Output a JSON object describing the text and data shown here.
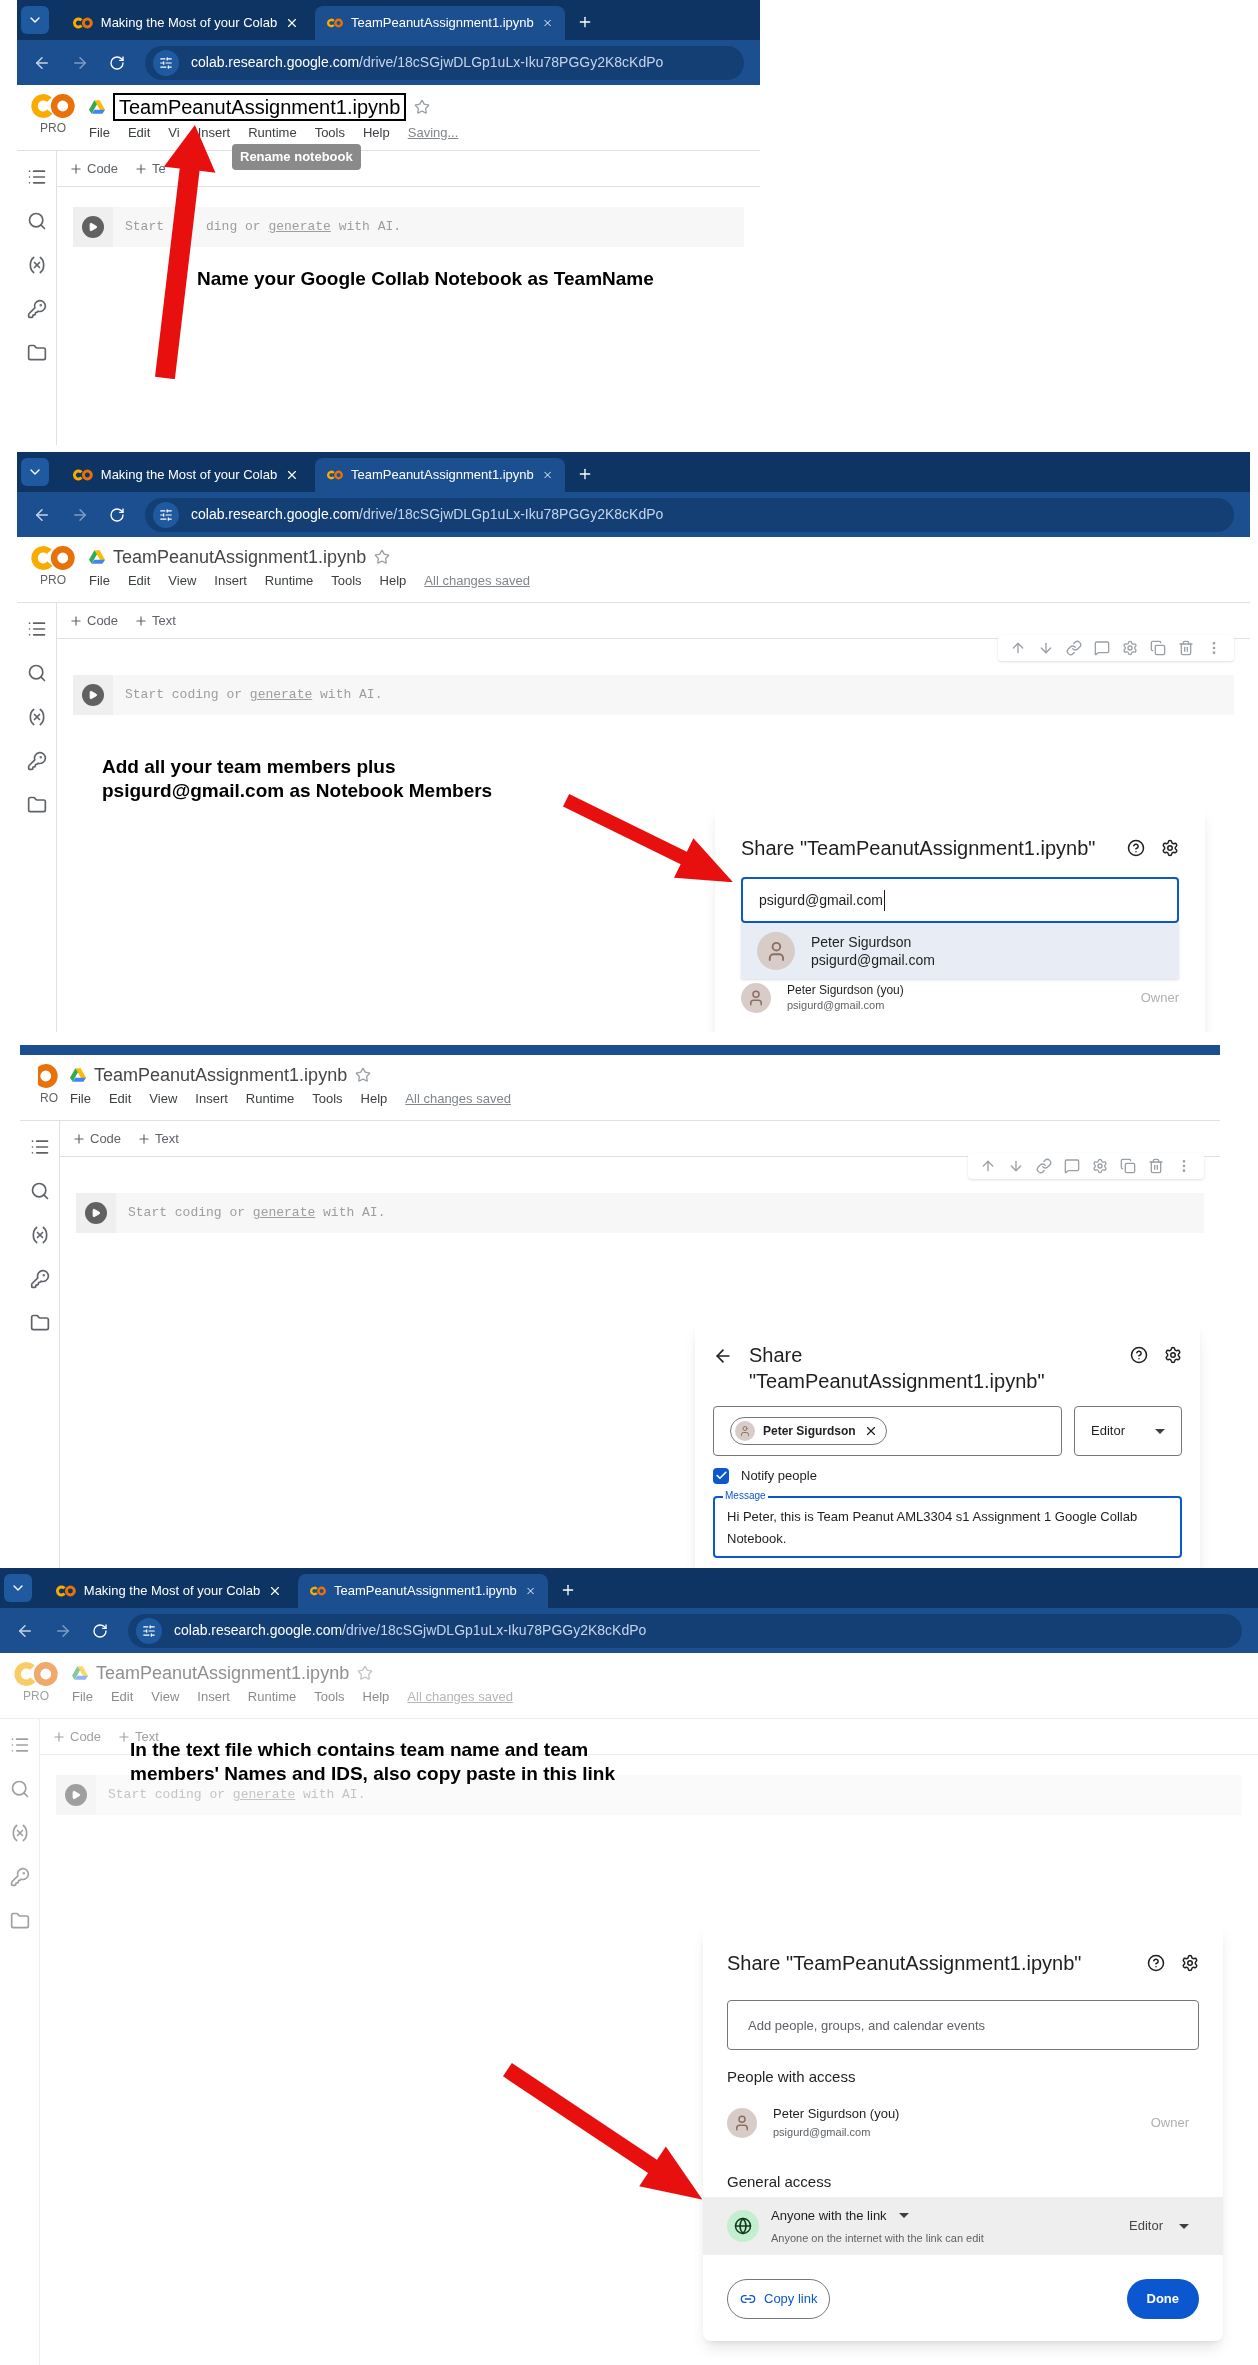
{
  "step_1": {
    "browser": {
      "tabs": [
        {
          "title": "Making the Most of your Colab",
          "selected": false
        },
        {
          "title": "TeamPeanutAssignment1.ipynb",
          "selected": true
        }
      ],
      "url_host": "colab.research.google.com",
      "url_path": "/drive/18cSGjwDLGp1uLx-Iku78PGGy2K8cKdPo"
    },
    "notebook": {
      "logo_label": "PRO",
      "logo_cropped": false,
      "dimmed": false,
      "filename": "TeamPeanutAssignment1.ipynb",
      "renaming": true,
      "menus": [
        "File",
        "Edit",
        "Vi",
        "Insert",
        "Runtime",
        "Tools",
        "Help"
      ],
      "status": "Saving...",
      "toolbar": [
        "Code",
        "Te"
      ],
      "cell_toolbar": false,
      "cell": [
        {
          "text": "Start",
          "underline": false,
          "covered_after": true
        },
        {
          "text": "ding or ",
          "underline": false,
          "covered_after": false
        },
        {
          "text": "generate",
          "underline": true,
          "covered_after": false
        },
        {
          "text": " with AI.",
          "underline": false,
          "covered_after": false
        }
      ]
    },
    "tooltip": "Rename notebook",
    "instruction": "Name your Google Collab Notebook as TeamName"
  },
  "step_2": {
    "browser": {
      "tabs": [
        {
          "title": "Making the Most of your Colab",
          "selected": false
        },
        {
          "title": "TeamPeanutAssignment1.ipynb",
          "selected": true
        }
      ],
      "url_host": "colab.research.google.com",
      "url_path": "/drive/18cSGjwDLGp1uLx-Iku78PGGy2K8cKdPo"
    },
    "notebook": {
      "logo_label": "PRO",
      "logo_cropped": false,
      "dimmed": false,
      "filename": "TeamPeanutAssignment1.ipynb",
      "renaming": false,
      "menus": [
        "File",
        "Edit",
        "View",
        "Insert",
        "Runtime",
        "Tools",
        "Help"
      ],
      "status": "All changes saved",
      "toolbar": [
        "Code",
        "Text"
      ],
      "cell_toolbar": true,
      "cell": [
        {
          "text": "Start coding or ",
          "underline": false
        },
        {
          "text": "generate",
          "underline": true
        },
        {
          "text": " with AI.",
          "underline": false
        }
      ]
    },
    "instruction_lines": [
      "Add all your team members plus",
      "psigurd@gmail.com as Notebook Members"
    ],
    "share": {
      "title": "Share \"TeamPeanutAssignment1.ipynb\"",
      "input_value": "psigurd@gmail.com",
      "suggestion": {
        "name": "Peter Sigurdson",
        "email": "psigurd@gmail.com"
      },
      "people": [
        {
          "name": "Peter Sigurdson (you)",
          "email": "psigurd@gmail.com",
          "role": "Owner"
        }
      ]
    }
  },
  "step_3": {
    "notebook": {
      "logo_label": "RO",
      "logo_cropped": true,
      "dimmed": false,
      "filename": "TeamPeanutAssignment1.ipynb",
      "renaming": false,
      "menus": [
        "File",
        "Edit",
        "View",
        "Insert",
        "Runtime",
        "Tools",
        "Help"
      ],
      "status": "All changes saved",
      "toolbar": [
        "Code",
        "Text"
      ],
      "cell_toolbar": true,
      "cell": [
        {
          "text": "Start coding or ",
          "underline": false
        },
        {
          "text": "generate",
          "underline": true
        },
        {
          "text": " with AI.",
          "underline": false
        }
      ]
    },
    "share": {
      "title_lines": [
        "Share",
        "\"TeamPeanutAssignment1.ipynb\""
      ],
      "chip": "Peter Sigurdson",
      "role": "Editor",
      "notify": {
        "label": "Notify people",
        "checked": true
      },
      "message_label": "Message",
      "message": "Hi Peter, this is Team Peanut AML3304 s1 Assignment 1 Google Collab Notebook."
    }
  },
  "step_4": {
    "browser": {
      "tabs": [
        {
          "title": "Making the Most of your Colab",
          "selected": false
        },
        {
          "title": "TeamPeanutAssignment1.ipynb",
          "selected": true
        }
      ],
      "url_host": "colab.research.google.com",
      "url_path": "/drive/18cSGjwDLGp1uLx-Iku78PGGy2K8cKdPo"
    },
    "notebook": {
      "logo_label": "PRO",
      "logo_cropped": false,
      "dimmed": true,
      "filename": "TeamPeanutAssignment1.ipynb",
      "renaming": false,
      "menus": [
        "File",
        "Edit",
        "View",
        "Insert",
        "Runtime",
        "Tools",
        "Help"
      ],
      "status": "All changes saved",
      "toolbar": [
        "Code",
        "Text"
      ],
      "cell_toolbar": false,
      "cell": [
        {
          "text": "Start coding or ",
          "underline": false
        },
        {
          "text": "generate",
          "underline": true
        },
        {
          "text": " with AI.",
          "underline": false
        }
      ]
    },
    "instruction_lines": [
      "In the text file which contains team name and team",
      "members' Names and IDS, also copy paste in this link"
    ],
    "share": {
      "title": "Share \"TeamPeanutAssignment1.ipynb\"",
      "input_placeholder": "Add people, groups, and calendar events",
      "people_heading": "People with access",
      "people": [
        {
          "name": "Peter Sigurdson (you)",
          "email": "psigurd@gmail.com",
          "role": "Owner"
        }
      ],
      "general_heading": "General access",
      "general": {
        "scope": "Anyone with the link",
        "description": "Anyone on the internet with the link can edit",
        "role": "Editor"
      },
      "copy_button": "Copy link",
      "done_button": "Done"
    }
  }
}
